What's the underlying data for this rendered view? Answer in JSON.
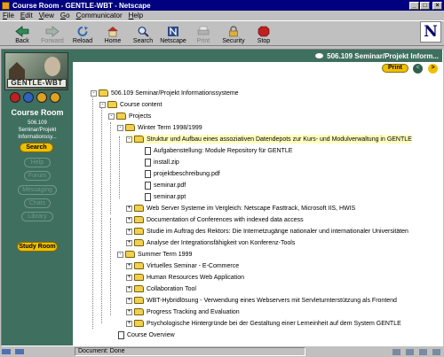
{
  "window": {
    "title": "Course Room - GENTLE-WBT - Netscape"
  },
  "menubar": [
    "File",
    "Edit",
    "View",
    "Go",
    "Communicator",
    "Help"
  ],
  "toolbar": {
    "buttons": [
      {
        "label": "Back",
        "icon": "back-arrow-icon",
        "enabled": true
      },
      {
        "label": "Forward",
        "icon": "forward-arrow-icon",
        "enabled": false
      },
      {
        "label": "Reload",
        "icon": "reload-icon",
        "enabled": true
      },
      {
        "label": "Home",
        "icon": "home-icon",
        "enabled": true
      },
      {
        "label": "Search",
        "icon": "search-icon",
        "enabled": true
      },
      {
        "label": "Netscape",
        "icon": "netscape-icon",
        "enabled": true
      },
      {
        "label": "Print",
        "icon": "print-icon",
        "enabled": false
      },
      {
        "label": "Security",
        "icon": "lock-icon",
        "enabled": true
      },
      {
        "label": "Stop",
        "icon": "stop-icon",
        "enabled": true
      }
    ],
    "throbber": "N"
  },
  "sidebar": {
    "logo_text": "GENTLE-WBT",
    "title": "Course Room",
    "subtitle_lines": [
      "506.109",
      "Seminar/Projekt",
      "Informationssy..."
    ],
    "active_button": "Search",
    "inactive_buttons": [
      "Help",
      "Forum",
      "Messaging",
      "Chats",
      "Library"
    ],
    "study_room": "Study Room"
  },
  "header": {
    "course_title": "506.109 Seminar/Projekt Inform...",
    "print_label": "Print",
    "prev_label": "<",
    "next_label": ">"
  },
  "tree": {
    "root": "506.109 Seminar/Projekt Informationssysteme",
    "course_content": "Course content",
    "projects": "Projects",
    "winter": "Winter Term 1998/1999",
    "winter_highlight": "Struktur und Aufbau eines assoziativen Datendepots zur Kurs- und Modulverwaltung in GENTLE",
    "winter_files": [
      "Aufgabenstellung: Module Repository für GENTLE",
      "install.zip",
      "projektbeschreibung.pdf",
      "seminar.pdf",
      "seminar.ppt"
    ],
    "winter_items": [
      "Web Server Systeme im Vergleich: Netscape Fasttrack, Microsoft IIS, HWIS",
      "Documentation of Conferences with indexed data access",
      "Studie im Auftrag des Rektors: Die Internetzugänge nationaler und internationaler Universitäten",
      "Analyse der Integrationsfähigkeit von Konferenz-Tools"
    ],
    "summer": "Summer Term 1999",
    "summer_items": [
      "Virtuelles Seminar - E-Commerce",
      "Human Resources Web Application",
      "Collaboration Tool",
      "WBT-Hybridlösung - Verwendung eines Webservers mit Servleturnterstützung als Frontend",
      "Progress Tracking and Evaluation",
      "Psychologische Hintergründe bei der Gestaltung einer Lerneinheit auf dem System GENTLE"
    ],
    "overview": "Course Overview"
  },
  "status": {
    "text": "Document: Done"
  },
  "colors": {
    "sidebar": "#3f6f5f",
    "accent": "#f0c000",
    "titlebar": "#000080"
  }
}
